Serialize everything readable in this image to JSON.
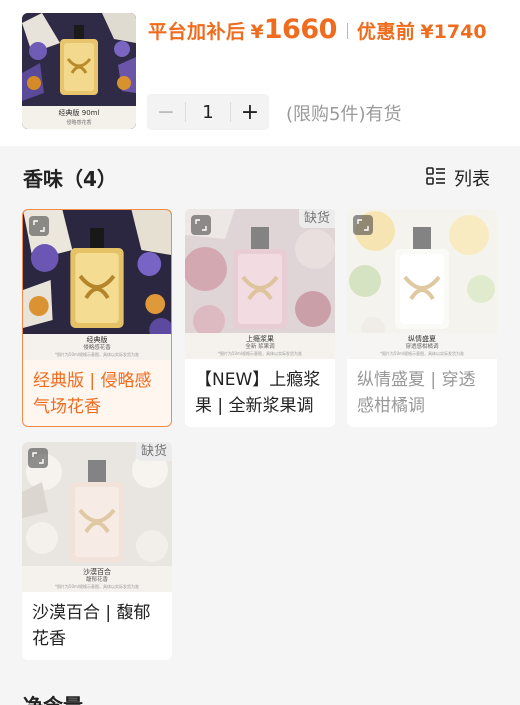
{
  "product_thumb": {
    "caption_line1": "经典版 90ml",
    "caption_line2": "侵略感花香"
  },
  "price": {
    "platform_label": "平台加补后",
    "platform_currency": "¥",
    "platform_value": "1660",
    "original_label": "优惠前",
    "original_currency": "¥",
    "original_value": "1740"
  },
  "quantity": {
    "minus_label": "−",
    "value": "1",
    "plus_label": "+"
  },
  "stock_text": "(限购5件)有货",
  "section": {
    "title": "香味（4）",
    "list_toggle_label": "列表",
    "list_icon": "list-icon"
  },
  "variants": [
    {
      "name": "经典版 | 侵略感气场花香",
      "tag_line1": "经典版",
      "tag_line2": "侵略感花香",
      "tag_line3": "*图片为50ml规格示意图，具体以实际发货为准",
      "selected": true,
      "out_of_stock": false,
      "out_of_stock_label": ""
    },
    {
      "name": "【NEW】上瘾浆果 | 全新浆果调",
      "tag_line1": "上瘾浆果",
      "tag_line2": "全新 浆果调",
      "tag_line3": "*图片为50ml规格示意图，具体以实际发货为准",
      "selected": false,
      "out_of_stock": true,
      "out_of_stock_label": "缺货"
    },
    {
      "name": "纵情盛夏 | 穿透感柑橘调",
      "tag_line1": "纵情盛夏",
      "tag_line2": "穿透感柑橘调",
      "tag_line3": "*图片为50ml规格示意图，具体以实际发货为准",
      "selected": false,
      "out_of_stock": false,
      "out_of_stock_label": ""
    },
    {
      "name": "沙漠百合 | 馥郁花香",
      "tag_line1": "沙漠百合",
      "tag_line2": "馥郁花香",
      "tag_line3": "*图片为50ml规格示意图，具体以实际发货为准",
      "selected": false,
      "out_of_stock": true,
      "out_of_stock_label": "缺货"
    }
  ],
  "next_section_title": "净含量",
  "colors": {
    "accent": "#ef6c1e",
    "selected_border": "#f18a4b",
    "selected_bg": "#fff6f0",
    "muted_text": "#999999",
    "page_bg": "#f5f5f5"
  }
}
